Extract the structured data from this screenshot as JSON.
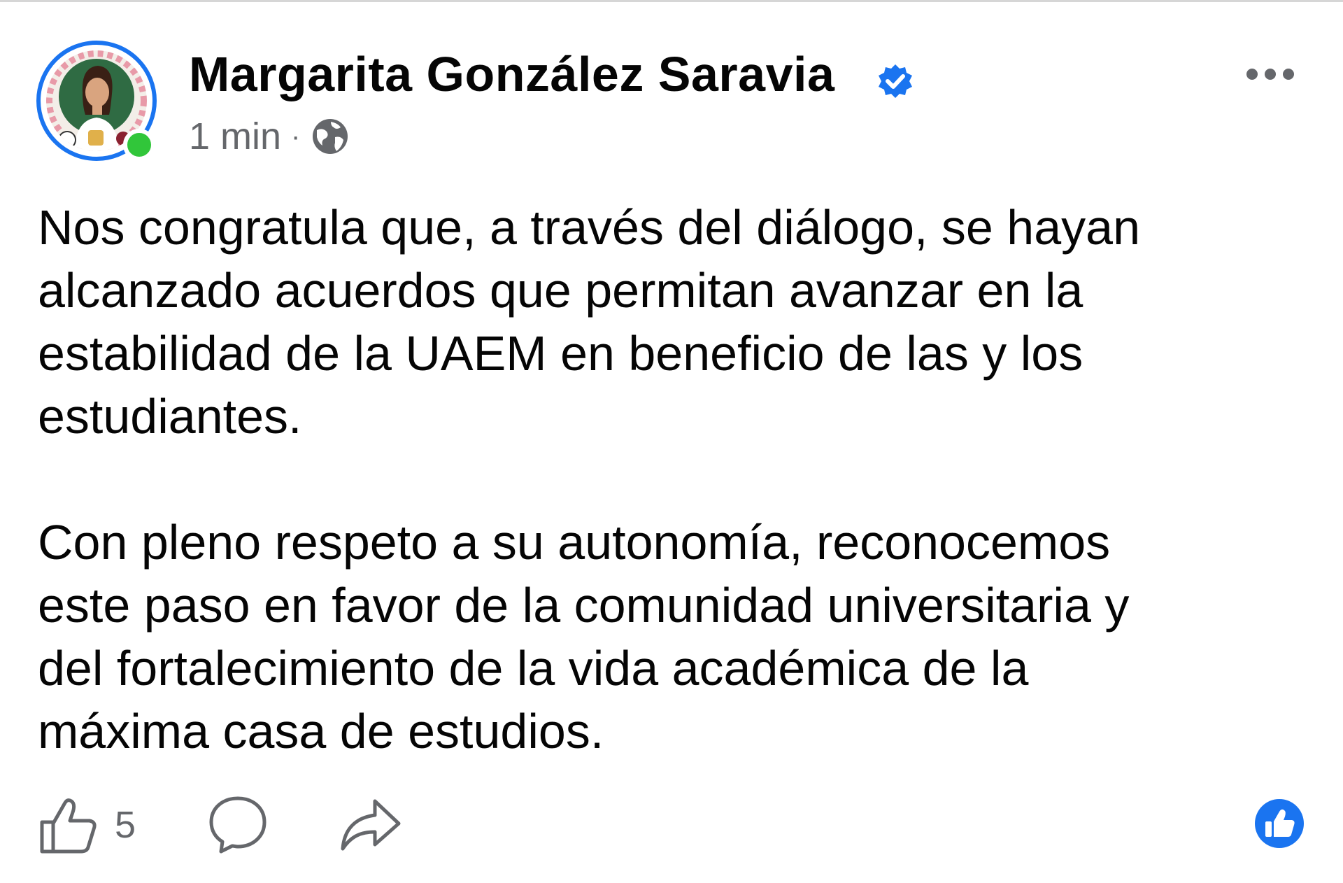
{
  "post": {
    "author": "Margarita González Saravia",
    "time": "1 min",
    "separator": "·",
    "audience_icon": "globe-icon",
    "verified_icon": "verified-badge-icon",
    "paragraphs": [
      "Nos congratula que, a través del diálogo, se hayan\nalcanzado acuerdos que permitan avanzar en la\nestabilidad de la UAEM en beneficio de las y los\nestudiantes.",
      "Con pleno respeto a su autonomía, reconocemos\neste paso en favor de la comunidad universitaria y\ndel fortalecimiento de la vida académica de la\nmáxima casa de estudios."
    ],
    "like_count": "5"
  },
  "colors": {
    "accent": "#1a74f0",
    "online": "#31c63a",
    "secondary_text": "#65676b"
  }
}
